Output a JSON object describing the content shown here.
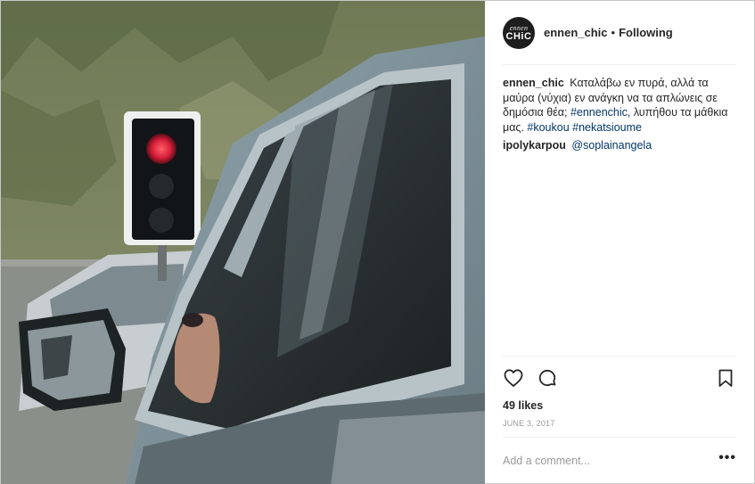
{
  "post": {
    "photo_alt": "",
    "author": {
      "username": "ennen_chic",
      "avatar_top": "ennen",
      "avatar_bottom": "CHiC",
      "follow_state": "Following",
      "separator": "•"
    },
    "comments": [
      {
        "author": "ennen_chic",
        "parts": [
          {
            "type": "text",
            "value": "Καταλάβω εν πυρά, αλλά τα μαύρα (νύχια) εν ανάγκη να τα απλώνεις σε δημόσια θέα; "
          },
          {
            "type": "tag",
            "value": "#ennenchic"
          },
          {
            "type": "text",
            "value": ", λυπήθου τα μάθκια μας. "
          },
          {
            "type": "tag",
            "value": "#koukou"
          },
          {
            "type": "text",
            "value": " "
          },
          {
            "type": "tag",
            "value": "#nekatsioume"
          }
        ]
      },
      {
        "author": "ipolykarpou",
        "parts": [
          {
            "type": "tag",
            "value": "@soplainangela"
          }
        ]
      }
    ],
    "actions": {
      "like_icon": "heart-icon",
      "comment_icon": "speech-bubble-icon",
      "save_icon": "bookmark-icon"
    },
    "likes": "49 likes",
    "date": "JUNE 3, 2017",
    "add_comment": {
      "placeholder": "Add a comment...",
      "more_label": "•••"
    }
  }
}
